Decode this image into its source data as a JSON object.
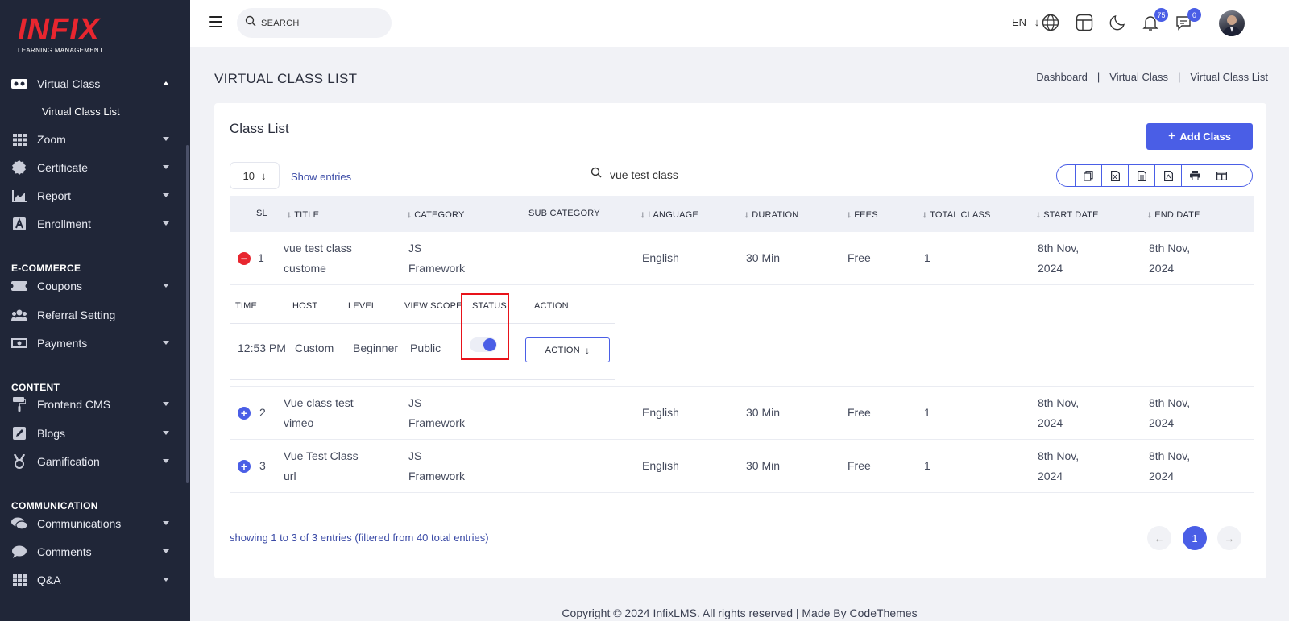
{
  "brand": {
    "logo_text": "INFIX",
    "logo_sub": "LEARNING MANAGEMENT",
    "accent": "#4a5ee6",
    "logo_color": "#e8262f",
    "sidebar_bg": "#202638"
  },
  "sidebar": {
    "virtual_class": "Virtual Class",
    "virtual_class_list": "Virtual Class List",
    "zoom": "Zoom",
    "certificate": "Certificate",
    "report": "Report",
    "enrollment": "Enrollment",
    "section_ecommerce": "E-COMMERCE",
    "coupons": "Coupons",
    "referral_setting": "Referral Setting",
    "payments": "Payments",
    "section_content": "CONTENT",
    "frontend_cms": "Frontend CMS",
    "blogs": "Blogs",
    "gamification": "Gamification",
    "section_communication": "COMMUNICATION",
    "communications": "Communications",
    "comments": "Comments",
    "qa": "Q&A"
  },
  "topbar": {
    "search_placeholder": "SEARCH",
    "language": "EN",
    "notification_count": "75",
    "message_count": "0"
  },
  "page": {
    "title": "VIRTUAL CLASS LIST",
    "breadcrumb": [
      "Dashboard",
      "Virtual Class",
      "Virtual Class List"
    ]
  },
  "card": {
    "title": "Class List",
    "add_button": "Add Class",
    "page_length": "10",
    "page_length_label": "Show entries",
    "search_value": "vue test class",
    "export_icons": [
      "copy-icon",
      "excel-icon",
      "csv-icon",
      "pdf-icon",
      "print-icon",
      "columns-icon"
    ]
  },
  "table": {
    "headers": {
      "sl": "SL",
      "title": "TITLE",
      "category": "CATEGORY",
      "sub_category": "SUB CATEGORY",
      "language": "LANGUAGE",
      "duration": "DURATION",
      "fees": "FEES",
      "total_class": "TOTAL CLASS",
      "start_date": "START DATE",
      "end_date": "END DATE"
    },
    "rows": [
      {
        "sl": "1",
        "title_1": "vue test class",
        "title_2": "custome",
        "cat_1": "JS",
        "cat_2": "Framework",
        "language": "English",
        "duration": "30 Min",
        "fees": "Free",
        "total_class": "1",
        "start_1": "8th Nov,",
        "start_2": "2024",
        "end_1": "8th Nov,",
        "end_2": "2024"
      },
      {
        "sl": "2",
        "title_1": "Vue class test",
        "title_2": "vimeo",
        "cat_1": "JS",
        "cat_2": "Framework",
        "language": "English",
        "duration": "30 Min",
        "fees": "Free",
        "total_class": "1",
        "start_1": "8th Nov,",
        "start_2": "2024",
        "end_1": "8th Nov,",
        "end_2": "2024"
      },
      {
        "sl": "3",
        "title_1": "Vue Test Class",
        "title_2": "url",
        "cat_1": "JS",
        "cat_2": "Framework",
        "language": "English",
        "duration": "30 Min",
        "fees": "Free",
        "total_class": "1",
        "start_1": "8th Nov,",
        "start_2": "2024",
        "end_1": "8th Nov,",
        "end_2": "2024"
      }
    ],
    "child": {
      "headers": {
        "time": "TIME",
        "host": "HOST",
        "level": "LEVEL",
        "view_scope": "VIEW SCOPE",
        "status": "STATUS",
        "action": "ACTION"
      },
      "values": {
        "time": "12:53 PM",
        "host": "Custom",
        "level": "Beginner",
        "view_scope": "Public",
        "status_on": true,
        "action_label": "ACTION"
      }
    }
  },
  "footer_info": {
    "showing": "showing 1 to 3 of 3 entries (filtered from 40 total entries)",
    "current_page": "1"
  },
  "footer": "Copyright © 2024 InfixLMS. All rights reserved | Made By CodeThemes"
}
